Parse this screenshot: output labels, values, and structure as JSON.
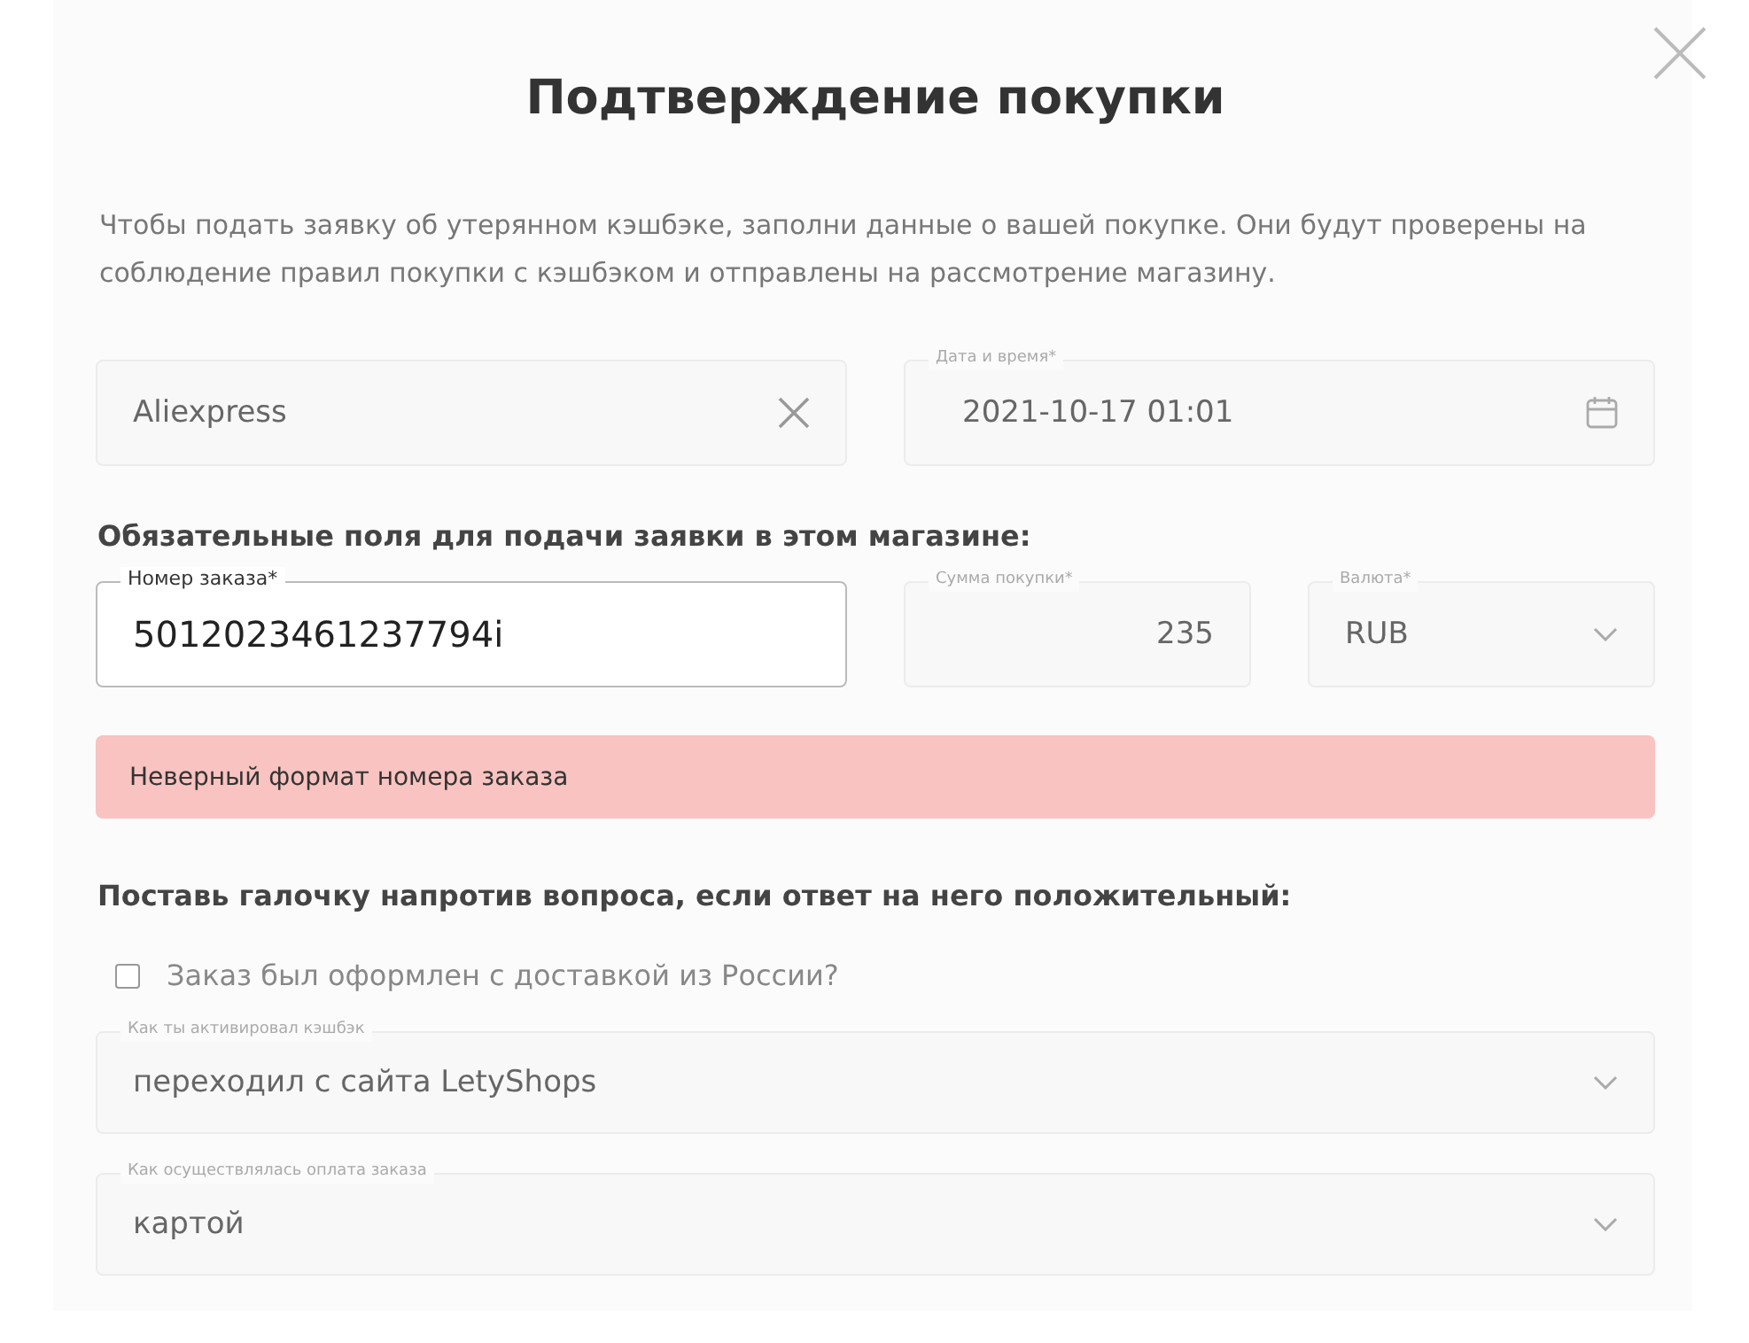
{
  "title": "Подтверждение покупки",
  "description": "Чтобы подать заявку об утерянном кэшбэке, заполни данные о вашей покупке. Они будут проверены на соблюдение правил покупки с кэшбэком и отправлены на рассмотрение магазину.",
  "store_field": {
    "value": "Aliexpress"
  },
  "date_field": {
    "label": "Дата и время*",
    "value": "2021-10-17 01:01"
  },
  "required_heading": "Обязательные поля для подачи заявки в этом магазине:",
  "order_field": {
    "label": "Номер заказа*",
    "value": "5012023461237794i",
    "focused": true
  },
  "amount_field": {
    "label": "Сумма покупки*",
    "value": "235"
  },
  "currency_field": {
    "label": "Валюта*",
    "value": "RUB"
  },
  "error_message": "Неверный формат номера заказа",
  "questions_heading": "Поставь галочку напротив вопроса, если ответ на него положительный:",
  "questions": [
    {
      "kind": "checkbox",
      "label": "Заказ был оформлен с доставкой из России?",
      "checked": false
    },
    {
      "kind": "select",
      "label": "Как ты активировал кэшбэк",
      "value": "переходил с сайта LetyShops"
    },
    {
      "kind": "select",
      "label": "Как осуществлялась оплата заказа",
      "value": "картой"
    }
  ]
}
